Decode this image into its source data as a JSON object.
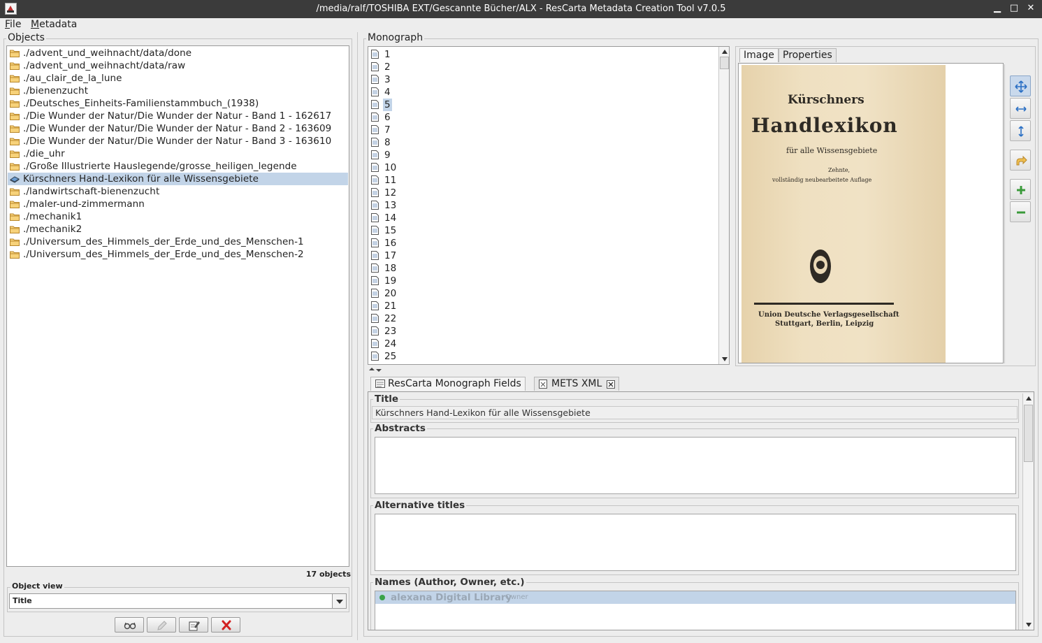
{
  "window": {
    "title": "/media/ralf/TOSHIBA EXT/Gescannte Bücher/ALX - ResCarta Metadata Creation Tool v7.0.5",
    "minimize": "▁",
    "maximize": "□",
    "close": "✕"
  },
  "menu": {
    "file_mnemonic": "F",
    "file_rest": "ile",
    "metadata_mnemonic": "M",
    "metadata_rest": "etadata"
  },
  "objects": {
    "legend": "Objects",
    "items": [
      "./advent_und_weihnacht/data/done",
      "./advent_und_weihnacht/data/raw",
      "./au_clair_de_la_lune",
      "./bienenzucht",
      "./Deutsches_Einheits-Familienstammbuch_(1938)",
      "./Die Wunder der Natur/Die Wunder der Natur - Band 1 - 162617",
      "./Die Wunder der Natur/Die Wunder der Natur - Band 2 - 163609",
      "./Die Wunder der Natur/Die Wunder der Natur - Band 3 - 163610",
      "./die_uhr",
      "./Große Illustrierte Hauslegende/grosse_heiligen_legende",
      "Kürschners Hand-Lexikon für alle Wissensgebiete",
      "./landwirtschaft-bienenzucht",
      "./maler-und-zimmermann",
      "./mechanik1",
      "./mechanik2",
      "./Universum_des_Himmels_der_Erde_und_des_Menschen-1",
      "./Universum_des_Himmels_der_Erde_und_des_Menschen-2"
    ],
    "selected_index": 10,
    "count": "17 objects",
    "view_legend": "Object view",
    "view_value": "Title"
  },
  "monograph": {
    "legend": "Monograph",
    "pages": [
      "1",
      "2",
      "3",
      "4",
      "5",
      "6",
      "7",
      "8",
      "9",
      "10",
      "11",
      "12",
      "13",
      "14",
      "15",
      "16",
      "17",
      "18",
      "19",
      "20",
      "21",
      "22",
      "23",
      "24",
      "25"
    ],
    "selected_page": "5",
    "tabs": {
      "image": "Image",
      "properties": "Properties"
    },
    "scan": {
      "line1": "Kürschners",
      "line2": "Handlexikon",
      "line3": "für alle Wissensgebiete",
      "line4": "Zehnte,",
      "line5": "vollständig neubearbeitete Auflage",
      "line6": "Union Deutsche Verlagsgesellschaft",
      "line7": "Stuttgart, Berlin, Leipzig"
    }
  },
  "fields": {
    "tab_fields": "ResCarta Monograph Fields",
    "tab_xml": "METS XML",
    "title_legend": "Title",
    "title_value": "Kürschners Hand-Lexikon für alle Wissensgebiete",
    "abstracts_legend": "Abstracts",
    "alt_titles_legend": "Alternative titles",
    "names_legend": "Names (Author, Owner, etc.)",
    "name_value": "alexana Digital Library",
    "name_role": "Owner"
  },
  "colors": {
    "selection": "#c2d4e8",
    "titlebar": "#3b3b3b",
    "folder": "#e8b94a",
    "delete_red": "#d22020",
    "add_green": "#3a9a3a"
  }
}
